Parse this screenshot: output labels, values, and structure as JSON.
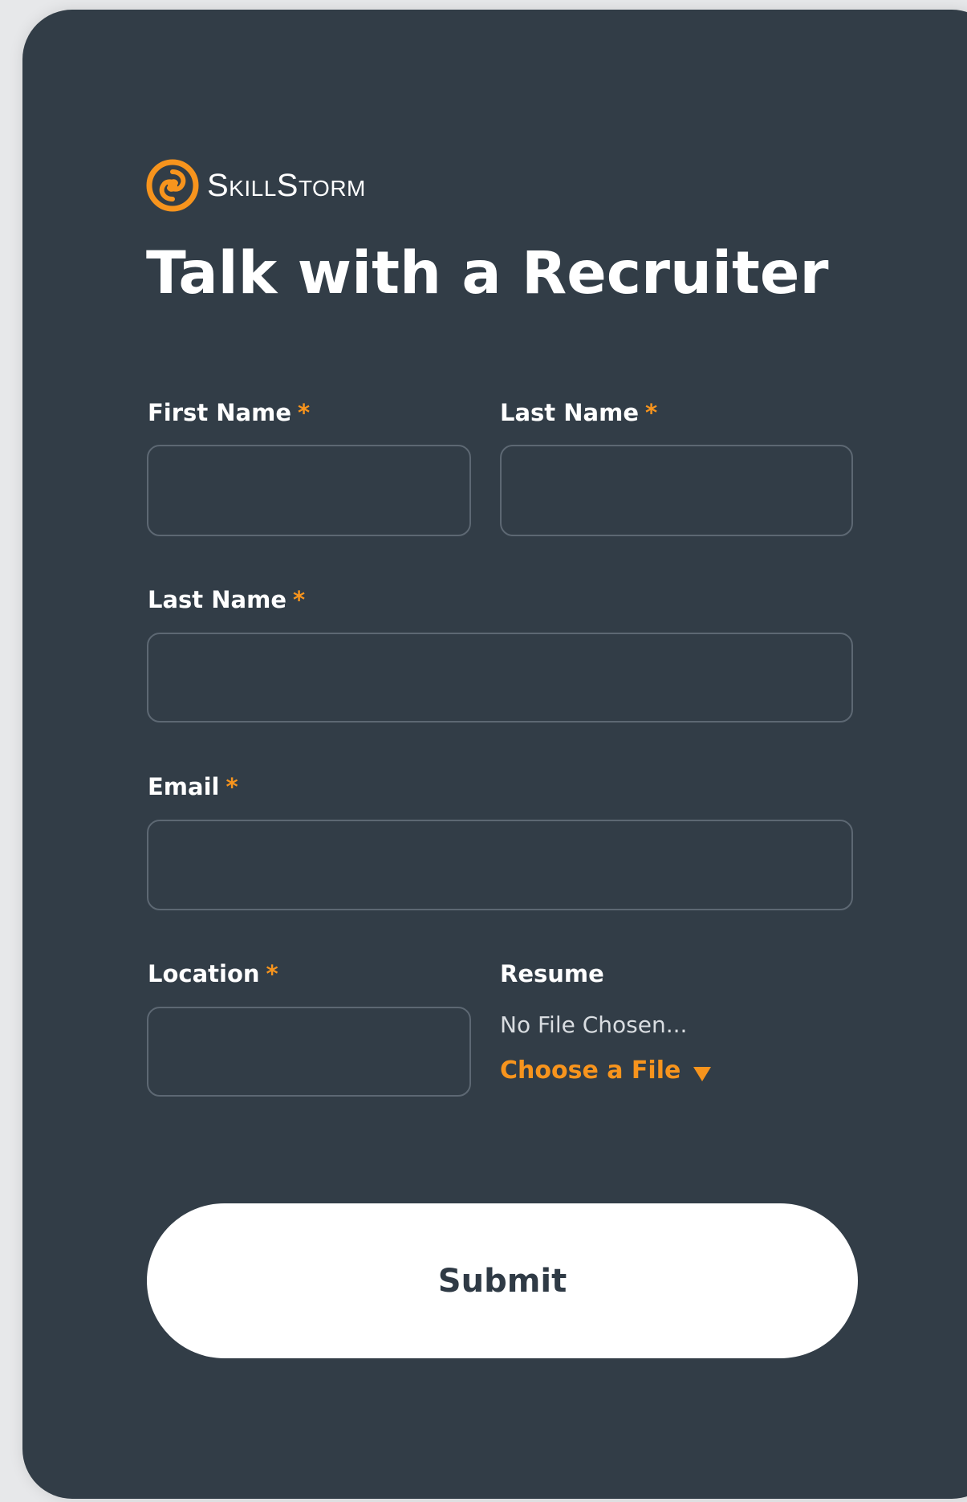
{
  "brand": {
    "name": "SkillStorm",
    "logo_icon": "skillstorm-swirl-icon",
    "accent_color": "#f7941d"
  },
  "page_title": "Talk with a Recruiter",
  "form": {
    "required_marker": "*",
    "first_name": {
      "label": "First Name",
      "value": ""
    },
    "last_name": {
      "label": "Last Name",
      "value": ""
    },
    "last_name_full": {
      "label": "Last Name",
      "value": ""
    },
    "email": {
      "label": "Email",
      "value": ""
    },
    "location": {
      "label": "Location",
      "value": ""
    },
    "resume": {
      "label": "Resume",
      "status": "No File Chosen...",
      "choose_label": "Choose a File",
      "choose_icon": "caret-down-icon"
    },
    "submit_label": "Submit"
  },
  "colors": {
    "card_background": "#323d47",
    "page_background": "#e7e8ea",
    "input_border": "#5d6873",
    "button_background": "#ffffff",
    "button_text": "#2f3a45"
  }
}
